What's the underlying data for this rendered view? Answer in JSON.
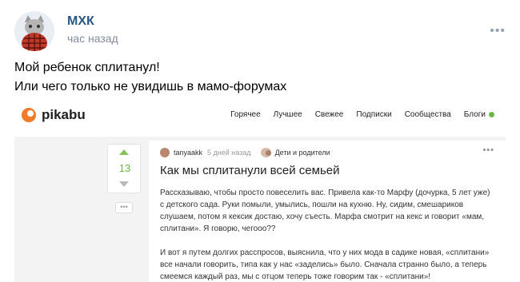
{
  "post": {
    "author": "МХК",
    "time": "час назад",
    "more": "•••",
    "text_line1": "Мой ребенок сплитанул!",
    "text_line2": "Или чего только не увидишь в мамо-форумах"
  },
  "embed": {
    "brand": "pikabu",
    "menu": [
      "Горячее",
      "Лучшее",
      "Свежее",
      "Подписки",
      "Сообщества",
      "Блоги"
    ],
    "vote_count": "13",
    "more_small": "•••",
    "story": {
      "author": "tanyaakk",
      "time": "5 дней назад",
      "community": "Дети и родители",
      "more": "•••",
      "title": "Как мы сплитанули всей семьей",
      "paragraph1": "Рассказываю, чтобы просто повеселить вас. Привела как-то Марфу (дочурка, 5 лет уже) с детского сада. Руки помыли, умылись, пошли на кухню. Ну, сидим, смешариков слушаем, потом я кексик достаю, хочу съесть. Марфа смотрит на кекс и говорит «мам, сплитани». Я говорю, чегооо??",
      "paragraph2": "И вот я путем долгих расспросов, выяснила, что у них мода в садике новая, «сплитани» все начали говорить, типа как у нас «заделись» было. Сначала странно было, а теперь смеемся каждый раз, мы с отцом теперь тоже говорим так -  «сплитани»!"
    }
  },
  "colors": {
    "author_link": "#2a5885",
    "muted": "#818c99",
    "pikabu_orange": "#f07c27",
    "pikabu_green": "#6bb449"
  },
  "icons": {
    "avatar": "cat-avatar",
    "logo": "pikabu-logo-icon",
    "vote_up": "arrow-up-icon",
    "vote_down": "arrow-down-icon",
    "blog_dot": "green-dot-icon"
  }
}
